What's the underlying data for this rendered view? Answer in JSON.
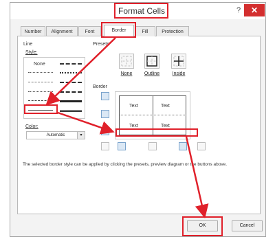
{
  "window": {
    "title": "Format Cells",
    "help": "?",
    "close": "✕"
  },
  "tabs": [
    "Number",
    "Alignment",
    "Font",
    "Border",
    "Fill",
    "Protection"
  ],
  "line": {
    "group_label": "Line",
    "style_label": "Style:",
    "none_label": "None",
    "color_label": "Color:",
    "color_value": "Automatic"
  },
  "presets": {
    "group_label": "Presets",
    "items": [
      "None",
      "Outline",
      "Inside"
    ]
  },
  "border": {
    "group_label": "Border",
    "preview_text": [
      "Text",
      "Text",
      "Text",
      "Text"
    ]
  },
  "description": "The selected border style can be applied by clicking the presets, preview diagram or the buttons above.",
  "buttons": {
    "ok": "OK",
    "cancel": "Cancel"
  },
  "colors": {
    "annotation_red": "#e0202a",
    "close_red": "#d32f2f",
    "selected_blue": "#dbe8f5"
  }
}
